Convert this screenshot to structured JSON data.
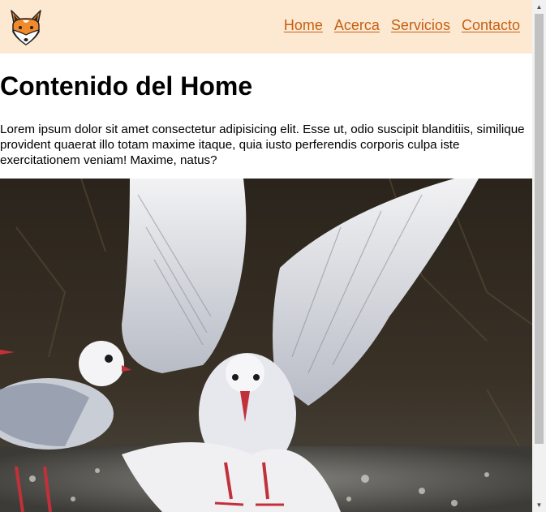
{
  "header": {
    "logo_icon": "fox-head-icon",
    "nav": [
      {
        "label": "Home"
      },
      {
        "label": "Acerca"
      },
      {
        "label": "Servicios"
      },
      {
        "label": "Contacto"
      }
    ]
  },
  "main": {
    "title": "Contenido del Home",
    "paragraph": "Lorem ipsum dolor sit amet consectetur adipisicing elit. Esse ut, odio suscipit blanditiis, similique provident quaerat illo totam maxime itaque, quia iusto perferendis corporis culpa iste exercitationem veniam! Maxime, natus?",
    "image_subject": "seagulls-photo"
  },
  "colors": {
    "header_bg": "#fde9d2",
    "nav_link": "#c45f12",
    "fox_orange": "#f08a2c"
  },
  "scrollbar": {
    "up_arrow": "▲",
    "down_arrow": "▼"
  }
}
